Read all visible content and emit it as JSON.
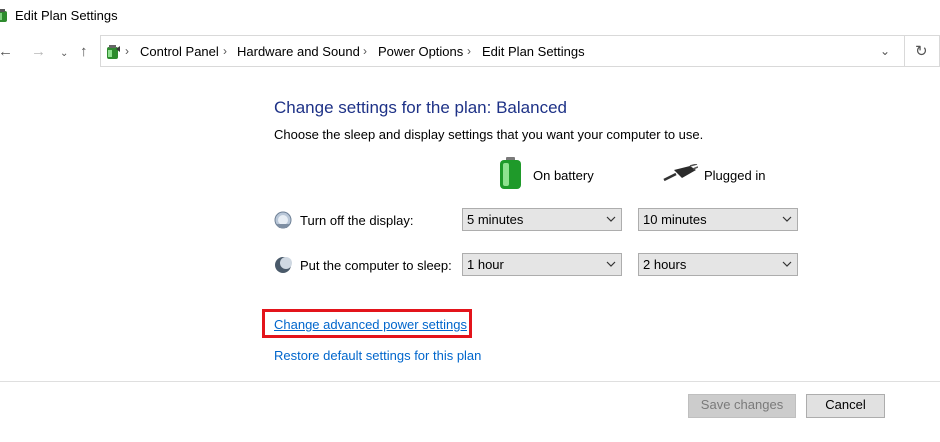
{
  "window": {
    "title": "Edit Plan Settings"
  },
  "nav": {
    "back_icon": "←",
    "forward_icon": "→",
    "recent_icon": "⌄",
    "up_icon": "↑",
    "address_dropdown_icon": "⌄",
    "refresh_icon": "↻",
    "breadcrumbs": [
      "Control Panel",
      "Hardware and Sound",
      "Power Options",
      "Edit Plan Settings"
    ],
    "separator": "›"
  },
  "main": {
    "heading": "Change settings for the plan: Balanced",
    "subheading": "Choose the sleep and display settings that you want your computer to use.",
    "columns": {
      "battery": "On battery",
      "plugged": "Plugged in"
    },
    "rows": [
      {
        "label": "Turn off the display:",
        "battery": "5 minutes",
        "plugged": "10 minutes"
      },
      {
        "label": "Put the computer to sleep:",
        "battery": "1 hour",
        "plugged": "2 hours"
      }
    ],
    "links": {
      "advanced": "Change advanced power settings",
      "restore": "Restore default settings for this plan"
    }
  },
  "footer": {
    "save": "Save changes",
    "cancel": "Cancel"
  },
  "colors": {
    "heading": "#1e3287",
    "link": "#0066cc",
    "highlight": "#e3141b"
  }
}
